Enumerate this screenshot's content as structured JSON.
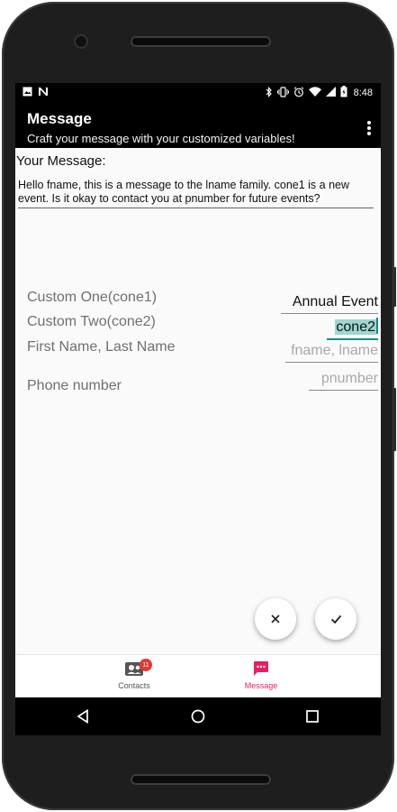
{
  "status_bar": {
    "time": "8:48",
    "left_icons": [
      "image-icon",
      "n-notification-icon"
    ],
    "right_icons": [
      "bluetooth-icon",
      "vibrate-icon",
      "alarm-icon",
      "wifi-icon",
      "signal-icon",
      "battery-icon"
    ]
  },
  "app_bar": {
    "title": "Message",
    "subtitle": "Craft your message with your customized variables!",
    "menu_icon": "overflow-menu-icon"
  },
  "message": {
    "heading": "Your Message:",
    "body": "Hello fname, this is a message to the lname family. cone1 is a new event. Is it okay to contact you at pnumber for future events?"
  },
  "fields": [
    {
      "label": "Custom One(cone1)",
      "value": "Annual Event",
      "placeholder": ""
    },
    {
      "label": "Custom Two(cone2)",
      "value": "cone2",
      "placeholder": ""
    },
    {
      "label": "First Name, Last Name",
      "value": "",
      "placeholder": "fname, lname"
    },
    {
      "label": "Phone number",
      "value": "",
      "placeholder": "pnumber"
    }
  ],
  "actions": {
    "cancel_icon": "close-icon",
    "confirm_icon": "check-icon"
  },
  "bottom_nav": {
    "items": [
      {
        "label": "Contacts",
        "icon": "contacts-icon",
        "badge": "11",
        "active": false
      },
      {
        "label": "Message",
        "icon": "message-icon",
        "active": true
      }
    ],
    "active_color": "#e91e63",
    "inactive_color": "#555555"
  },
  "colors": {
    "accent": "#0f8c8c",
    "highlight": "#9fd6d1",
    "app_bar": "#000000"
  }
}
